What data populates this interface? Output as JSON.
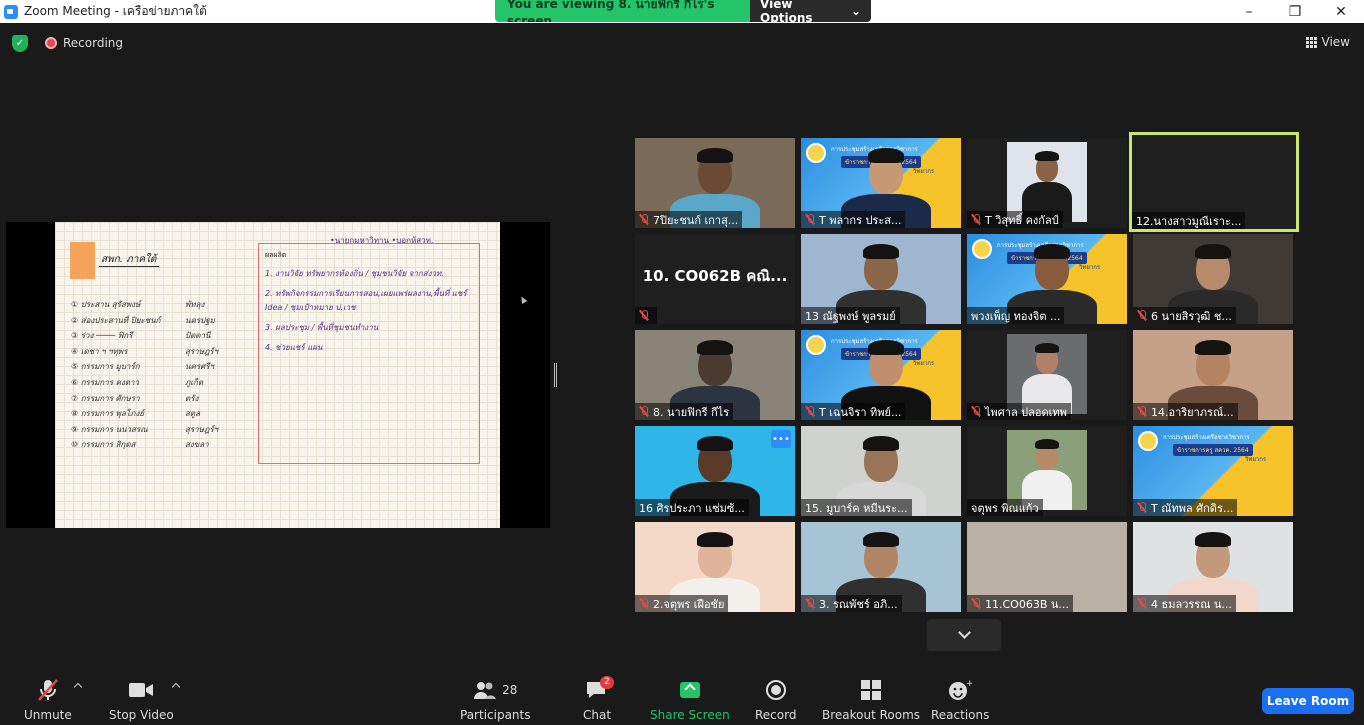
{
  "window": {
    "title": "Zoom Meeting - เครือข่ายภาคใต้",
    "controls": [
      "–",
      "❐",
      "✕"
    ]
  },
  "share_banner": {
    "message": "You are viewing 8. นายฟิกรี กีไร's screen",
    "options_label": "View Options"
  },
  "topbar": {
    "recording_label": "Recording",
    "view_label": "View"
  },
  "shared_content": {
    "header": "สพก. ภาคใต้",
    "top_note": "•นายกมหาวิทาน •บอกห้สวท.",
    "list_left": [
      "① ประสาน สุรัสพงษ์",
      "② ส่องประสานที่ ปิยะชนก์",
      "③ ร่วง ──── ฟิกรี",
      "④ เดชา ฯ ฯทุพร",
      "⑤ กรรมการ มูบาร์ก",
      "⑥ กรรมการ คงดาว",
      "⑦ กรรมการ ศักษรา",
      "⑧ กรรมการ พุลโภงย์",
      "⑨ กรรมการ นนวสรณ",
      "⑩ กรรมการ สิกุดส"
    ],
    "list_right": [
      "พัทลุง",
      "นครปฐม",
      "ปัตตานี",
      "สุราษฎร์ฯ",
      "นครศรีฯ",
      "ภูเก็ต",
      "ตรัง",
      "สตูล",
      "สุราษฎร์ฯ",
      "สงขลา"
    ],
    "box_label": "ผลผลิต",
    "box_lines": [
      "1. งานวิจัย ทรัพยากรท้องถิ่น / ชุมชนวิจัย จากส่งวท.",
      "2. ทรัพกิจกรรมการเรียนการสอน,เผยแพร่ผลงาน,พื้นที่ แชร์ Idea / ชุมเป้าหมาย ป.เวช",
      "3. ผลประชุม / พื้นที่ชุมชนทำงาน",
      "4. ช่วยแชร์ แผน"
    ]
  },
  "participants": [
    {
      "name": "7ปิยะชนก์ เกาสุ...",
      "muted": true,
      "kind": "video",
      "bg": "#7a6a58",
      "skin": "#6b4a34",
      "shirt": "#5aa7c9"
    },
    {
      "name": "T พลากร ประส...",
      "muted": true,
      "kind": "banner",
      "bg": "#1b3d8f",
      "skin": "#c79a74",
      "shirt": "#1c2a4a"
    },
    {
      "name": "T วิสุทธิ์ คงกัลป์",
      "muted": true,
      "kind": "photo",
      "bg": "#dfe4ea",
      "skin": "#8a6246",
      "shirt": "#1a1a1a"
    },
    {
      "name": "12.นางสาวมูณีเราะ...",
      "muted": false,
      "kind": "black",
      "active": true
    },
    {
      "name": "10. CO062B คณิ...",
      "muted": true,
      "kind": "text"
    },
    {
      "name": "13 ณัฐพงษ์ พูลรมย์",
      "muted": false,
      "kind": "video",
      "bg": "#9fb6d0",
      "skin": "#8a6548",
      "shirt": "#303030"
    },
    {
      "name": "พวงเพ็ญ ทองจิต ...",
      "muted": false,
      "kind": "banner",
      "bg": "#1b3d8f",
      "skin": "#8a5a3c",
      "shirt": "#2b2b2b"
    },
    {
      "name": "6 นายสิรวุฒิ ช...",
      "muted": true,
      "kind": "video",
      "bg": "#3f3a36",
      "skin": "#b88a6c",
      "shirt": "#2a2a2a"
    },
    {
      "name": "8. นายฟิกรี กีไร",
      "muted": true,
      "kind": "video",
      "bg": "#8a8378",
      "skin": "#4a3a30",
      "shirt": "#2b3440"
    },
    {
      "name": "T เฉนจิรา ทิพย์...",
      "muted": true,
      "kind": "banner",
      "bg": "#1b3d8f",
      "skin": "#c08e6c",
      "shirt": "#121212"
    },
    {
      "name": "ไพศาล ปลอดเทพ",
      "muted": true,
      "kind": "photo",
      "bg": "#6a6d70",
      "skin": "#b08068",
      "shirt": "#e8e8ea"
    },
    {
      "name": "14.อาริยาภรณ์...",
      "muted": true,
      "kind": "video",
      "bg": "#c6a088",
      "skin": "#b58262",
      "shirt": "#6a4c3c"
    },
    {
      "name": "16 ศิรประภา แซ่มซ้...",
      "muted": false,
      "kind": "video",
      "bg": "#2fb6e8",
      "skin": "#5a3a28",
      "shirt": "#1a1a1a",
      "more": true
    },
    {
      "name": "15. มูบาร์ค หมีนระ...",
      "muted": false,
      "kind": "video",
      "bg": "#cfd2cf",
      "skin": "#9a7458",
      "shirt": "#d8d8d8"
    },
    {
      "name": "จตุพร พิณแก้ว",
      "muted": false,
      "kind": "photo",
      "bg": "#8aa07a",
      "skin": "#b68a66",
      "shirt": "#f0f0f0"
    },
    {
      "name": "T ณัทพล ศักดิร...",
      "muted": true,
      "kind": "banner-empty",
      "bg": "#1b3d8f"
    },
    {
      "name": "2.จตุพร เฝือชัย",
      "muted": true,
      "kind": "video",
      "bg": "#f4d8c8",
      "skin": "#e0b49a",
      "shirt": "#f3f0ec"
    },
    {
      "name": "3. รณพัชร์ อภิ...",
      "muted": true,
      "kind": "video",
      "bg": "#a7c4d4",
      "skin": "#b08566",
      "shirt": "#303030"
    },
    {
      "name": "11.CO063B น...",
      "muted": true,
      "kind": "blur",
      "bg": "#b9b1a6"
    },
    {
      "name": "4 ธมลวรรณ น...",
      "muted": true,
      "kind": "video",
      "bg": "#dfe2e2",
      "skin": "#c49a7c",
      "shirt": "#f2d8cc"
    }
  ],
  "banner_texts": {
    "title": "การประชุมสร้างเครือข่ายวิชาการ",
    "pill": "ข้าราชการครู สควค. 2564",
    "role": "วิทยากร"
  },
  "toolbar": {
    "unmute_label": "Unmute",
    "stop_video_label": "Stop Video",
    "participants_label": "Participants",
    "participants_count": "28",
    "chat_label": "Chat",
    "chat_badge": "2",
    "share_label": "Share Screen",
    "record_label": "Record",
    "breakout_label": "Breakout Rooms",
    "reactions_label": "Reactions",
    "leave_label": "Leave Room"
  },
  "colors": {
    "accent": "#2D8CFF",
    "share_green": "#23c46a",
    "muted_red": "#e04a4a",
    "active_outline": "#c9e86a"
  }
}
